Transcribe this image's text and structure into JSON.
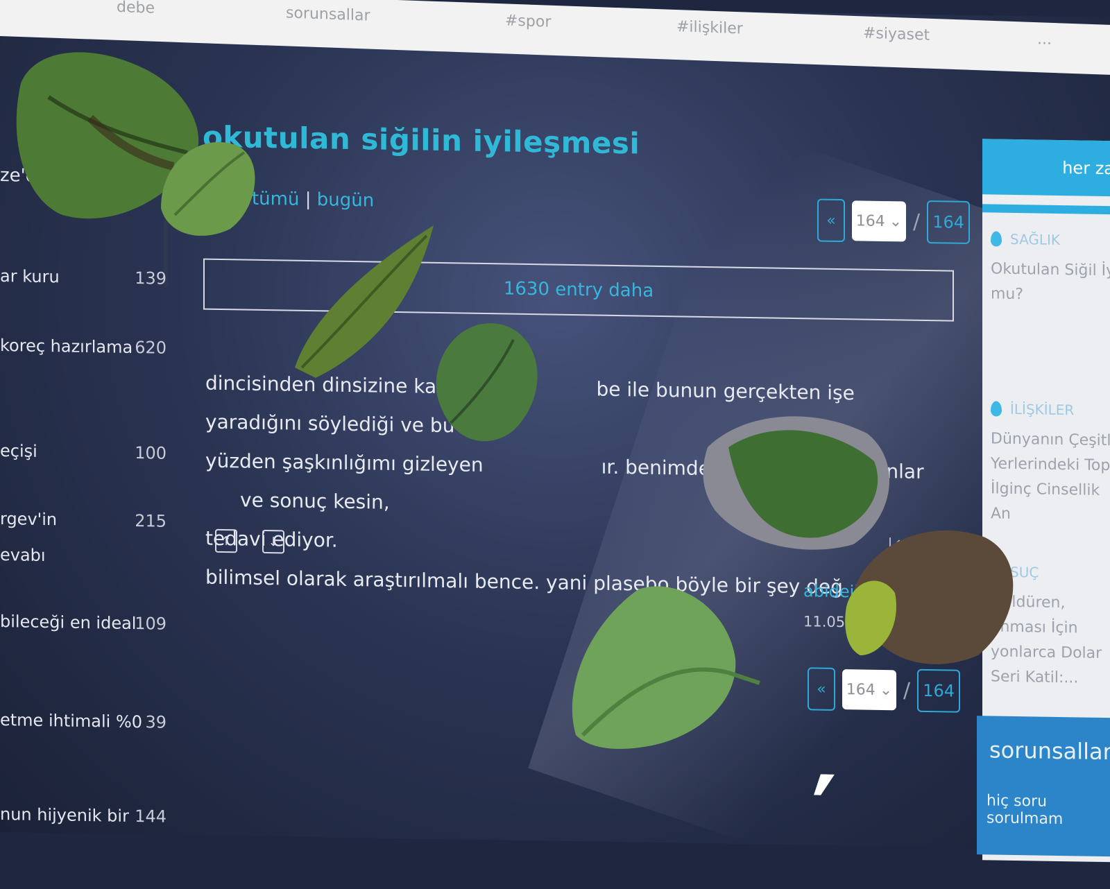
{
  "topbar": {
    "tabs": [
      "debe",
      "sorunsallar",
      "#spor",
      "#ilişkiler",
      "#siyaset",
      "..."
    ]
  },
  "topic": {
    "title": "okutulan siğilin iyileşmesi",
    "filter_label": "a:",
    "filter_all": "tümü",
    "filter_sep": "|",
    "filter_today": "bugün"
  },
  "pager_top": {
    "prev": "«",
    "current": "164",
    "slash": "/",
    "last": "164"
  },
  "more_entries": "1630 entry daha",
  "entry": {
    "line1": "dincisinden dinsizine kadar he",
    "line1b": "be ile bunun gerçekten işe yaradığını söylediği ve bu",
    "line2": "yüzden şaşkınlığımı gizleyen",
    "line2b": "ır. benimde etrafımda yaptıranlar",
    "line2c": "ve sonuç kesin,",
    "line3": "tedavi ediyor.",
    "line4": "bilimsel olarak araştırılmalı bence. yani plasebo böyle bir şey değ",
    "author": "abideihurri",
    "date": "11.05.2022"
  },
  "pager_bottom": {
    "prev": "«",
    "current": "164",
    "slash": "/",
    "last": "164"
  },
  "sidebar": {
    "heading": "ze'd",
    "items": [
      {
        "label": "ar kuru",
        "count": "139"
      },
      {
        "label": "koreç hazırlama",
        "count": "620"
      },
      {
        "label": "eçişi",
        "count": "100"
      },
      {
        "label": "rgev'in",
        "count": "215"
      },
      {
        "label": "evabı",
        "count": ""
      },
      {
        "label": "bileceği en ideal",
        "count": "109"
      },
      {
        "label": "etme ihtimali %0",
        "count": "39"
      },
      {
        "label": "nun hijyenik bir",
        "count": "144"
      }
    ]
  },
  "right": {
    "header": "her za",
    "cards": [
      {
        "category": "SAĞLIK",
        "title": "Okutulan Siğil İy mu?"
      },
      {
        "category": "İLİŞKİLER",
        "title": "Dünyanın Çeşitli Yerlerindeki Topl İlginç Cinsellik An"
      },
      {
        "category": "SUÇ",
        "title": "i Öldüren, anması İçin yonlarca Dolar Seri Katil:..."
      }
    ],
    "bottom_head": "sorunsallar",
    "bottom_sub": "hiç soru sorulmam"
  },
  "colors": {
    "accent": "#2fb9d6",
    "panel": "#eceef2",
    "background": "#2b3554"
  }
}
